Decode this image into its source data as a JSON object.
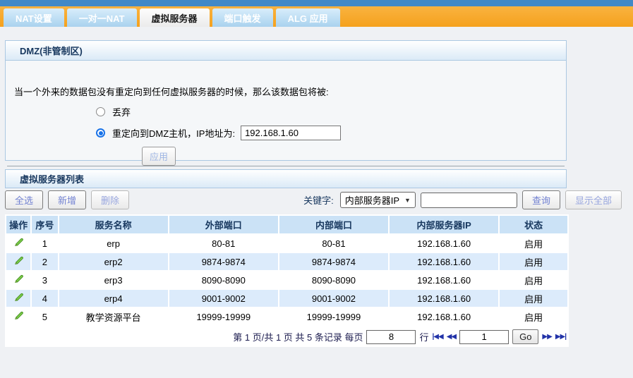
{
  "tabs": [
    {
      "label": "NAT设置",
      "active": false
    },
    {
      "label": "一对一NAT",
      "active": false
    },
    {
      "label": "虚拟服务器",
      "active": true
    },
    {
      "label": "端口触发",
      "active": false
    },
    {
      "label": "ALG 应用",
      "active": false
    }
  ],
  "dmz": {
    "title": "DMZ(非管制区)",
    "description": "当一个外来的数据包没有重定向到任何虚拟服务器的时候，那么该数据包将被:",
    "option_drop": "丢弃",
    "option_redirect": "重定向到DMZ主机，IP地址为:",
    "dmz_ip": "192.168.1.60",
    "apply_label": "应用"
  },
  "list": {
    "title": "虚拟服务器列表",
    "toolbar": {
      "select_all": "全选",
      "add": "新增",
      "delete": "删除",
      "keyword_label": "关键字:",
      "keyword_selected": "内部服务器IP",
      "search_value": "",
      "query": "查询",
      "show_all": "显示全部"
    },
    "table": {
      "columns": [
        "操作",
        "序号",
        "服务名称",
        "外部端口",
        "内部端口",
        "内部服务器IP",
        "状态"
      ],
      "rows": [
        {
          "no": "1",
          "name": "erp",
          "ext_port": "80-81",
          "int_port": "80-81",
          "ip": "192.168.1.60",
          "status": "启用"
        },
        {
          "no": "2",
          "name": "erp2",
          "ext_port": "9874-9874",
          "int_port": "9874-9874",
          "ip": "192.168.1.60",
          "status": "启用"
        },
        {
          "no": "3",
          "name": "erp3",
          "ext_port": "8090-8090",
          "int_port": "8090-8090",
          "ip": "192.168.1.60",
          "status": "启用"
        },
        {
          "no": "4",
          "name": "erp4",
          "ext_port": "9001-9002",
          "int_port": "9001-9002",
          "ip": "192.168.1.60",
          "status": "启用"
        },
        {
          "no": "5",
          "name": "教学资源平台",
          "ext_port": "19999-19999",
          "int_port": "19999-19999",
          "ip": "192.168.1.60",
          "status": "启用"
        }
      ]
    },
    "pagination": {
      "summary": "第 1 页/共 1 页 共 5 条记录 每页",
      "per_page": "8",
      "rows_suffix": "行",
      "first_icon": "|◀◀",
      "prev_icon": "◀◀",
      "page_input": "1",
      "go_label": "Go",
      "next_icon": "▶▶",
      "last_icon": "▶▶|"
    }
  },
  "colors": {
    "accent_orange": "#f5a11d",
    "top_strip_blue": "#4189c7",
    "panel_border": "#abc8e2",
    "table_header_bg": "#cbe2f6",
    "row_alt_bg": "#dcebfb",
    "header_text": "#17375e",
    "button_text": "#7282d2"
  }
}
